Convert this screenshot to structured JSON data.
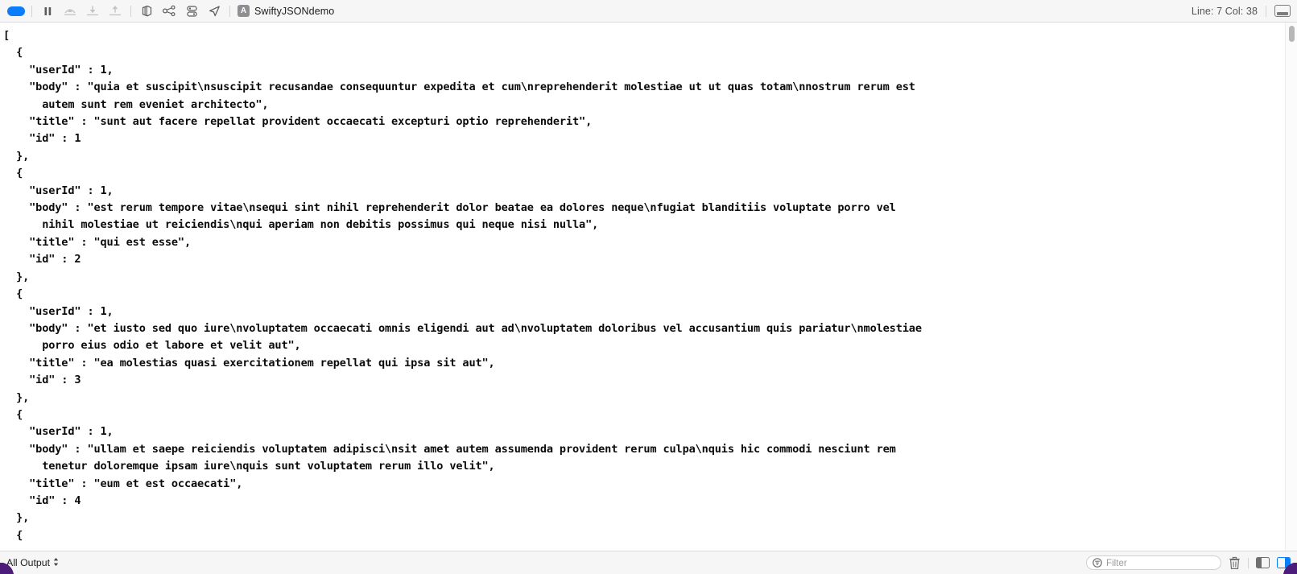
{
  "window": {
    "app_title": "SwiftyJSONdemo"
  },
  "toolbar": {
    "icons": [
      {
        "name": "run-stop-pill",
        "label": "Stop"
      },
      {
        "name": "pause-icon",
        "label": "Pause"
      },
      {
        "name": "step-over-icon",
        "label": "Step Over"
      },
      {
        "name": "step-into-icon",
        "label": "Step Into"
      },
      {
        "name": "step-out-icon",
        "label": "Step Out"
      },
      {
        "name": "view-debug-hierarchy-icon",
        "label": "Debug View Hierarchy"
      },
      {
        "name": "memory-graph-icon",
        "label": "Debug Memory Graph"
      },
      {
        "name": "environment-overrides-icon",
        "label": "Environment Overrides"
      },
      {
        "name": "location-simulate-icon",
        "label": "Simulate Location"
      }
    ],
    "app_icon_glyph": "A",
    "line_col": "Line: 7  Col: 38",
    "panel_toggle_name": "toggle-debug-area-button"
  },
  "bottombar": {
    "output_scope": "All Output",
    "output_scope_chevron": "⌃⌄",
    "filter": {
      "placeholder": "Filter",
      "value": "",
      "icon": "filter-circle-icon"
    },
    "trash_label": "Clear console",
    "split_left_label": "Show console only",
    "split_right_label": "Show variables only"
  },
  "console": {
    "lines": [
      "[",
      "  {",
      "    \"userId\" : 1,",
      "    \"body\" : \"quia et suscipit\\nsuscipit recusandae consequuntur expedita et cum\\nreprehenderit molestiae ut ut quas totam\\nnostrum rerum est",
      "      autem sunt rem eveniet architecto\",",
      "    \"title\" : \"sunt aut facere repellat provident occaecati excepturi optio reprehenderit\",",
      "    \"id\" : 1",
      "  },",
      "  {",
      "    \"userId\" : 1,",
      "    \"body\" : \"est rerum tempore vitae\\nsequi sint nihil reprehenderit dolor beatae ea dolores neque\\nfugiat blanditiis voluptate porro vel",
      "      nihil molestiae ut reiciendis\\nqui aperiam non debitis possimus qui neque nisi nulla\",",
      "    \"title\" : \"qui est esse\",",
      "    \"id\" : 2",
      "  },",
      "  {",
      "    \"userId\" : 1,",
      "    \"body\" : \"et iusto sed quo iure\\nvoluptatem occaecati omnis eligendi aut ad\\nvoluptatem doloribus vel accusantium quis pariatur\\nmolestiae",
      "      porro eius odio et labore et velit aut\",",
      "    \"title\" : \"ea molestias quasi exercitationem repellat qui ipsa sit aut\",",
      "    \"id\" : 3",
      "  },",
      "  {",
      "    \"userId\" : 1,",
      "    \"body\" : \"ullam et saepe reiciendis voluptatem adipisci\\nsit amet autem assumenda provident rerum culpa\\nquis hic commodi nesciunt rem",
      "      tenetur doloremque ipsam iure\\nquis sunt voluptatem rerum illo velit\",",
      "    \"title\" : \"eum et est occaecati\",",
      "    \"id\" : 4",
      "  },",
      "  {"
    ]
  },
  "colors": {
    "accent": "#0a7dfb",
    "toolbar_bg": "#f6f6f6",
    "console_text": "#0b0b0b",
    "muted_text": "#9a9a9e"
  }
}
